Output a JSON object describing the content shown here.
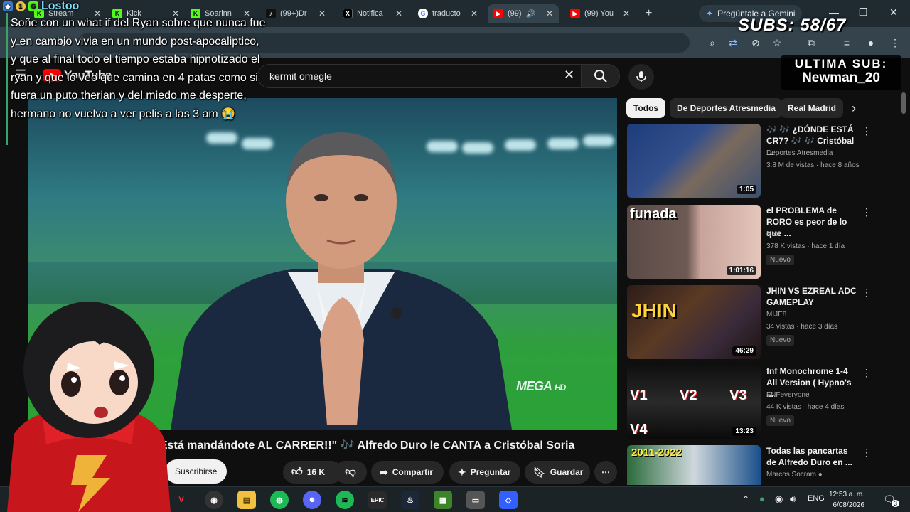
{
  "browser": {
    "tabs": [
      {
        "label": "Stream",
        "icon": "kick-icon"
      },
      {
        "label": "Kick",
        "icon": "kick-icon"
      },
      {
        "label": "Soarinn",
        "icon": "kick-icon"
      },
      {
        "label": "(99+)Dr",
        "icon": "tiktok-icon"
      },
      {
        "label": "Notifica",
        "icon": "x-icon"
      },
      {
        "label": "traducto",
        "icon": "google-icon"
      },
      {
        "label": "(99)",
        "icon": "youtube-icon"
      },
      {
        "label": "(99) You",
        "icon": "youtube-icon"
      }
    ],
    "gemini_label": "Pregúntale a Gemini"
  },
  "youtube": {
    "logo_text": "YouTube",
    "search_value": "kermit omegle",
    "video_title": "? ¡¡Está mandándote AL CARRER!!\" 🎶 Alfredo Duro le CANTA a Cristóbal Soria",
    "watermark": "MEGA",
    "watermark_hd": "HD",
    "actions": {
      "subscribe": "Suscribirse",
      "likes": "16 K",
      "share": "Compartir",
      "ask": "Preguntar",
      "save": "Guardar"
    },
    "chips": [
      "Todos",
      "De Deportes Atresmedia",
      "Real Madrid"
    ],
    "recommendations": [
      {
        "title": "🎶 🎶 ¿DÓNDE ESTÁ CR7? 🎶 🎶 Cristóbal ...",
        "channel": "Deportes Atresmedia",
        "meta": "3.8 M de vistas · hace 8 años",
        "duration": "1:05",
        "badge": "",
        "thumb_text": ""
      },
      {
        "title": "el PROBLEMA de RORO es peor de lo que ...",
        "channel": "Natx",
        "meta": "378 K vistas · hace 1 día",
        "duration": "1:01:16",
        "badge": "Nuevo",
        "thumb_text": "funada"
      },
      {
        "title": "JHIN VS EZREAL ADC GAMEPLAY",
        "channel": "MIJE8",
        "meta": "34 vistas · hace 3 días",
        "duration": "46:29",
        "badge": "Nuevo",
        "thumb_text": "JHIN"
      },
      {
        "title": "fnf Monochrome 1-4 All Version ( Hypno's ...",
        "channel": "FNFeveryone",
        "meta": "44 K vistas · hace 4 días",
        "duration": "13:23",
        "badge": "Nuevo",
        "thumb_text": "V1 V2 V3 V4"
      },
      {
        "title": "Todas las pancartas de Alfredo Duro en ...",
        "channel": "Marcos Socram ●",
        "meta": "",
        "duration": "",
        "badge": "",
        "thumb_text": "2011-2022"
      }
    ]
  },
  "overlay": {
    "chat_user": "Lostoo",
    "chat_message": "Soñe con un what if del Ryan sobre que nunca fue y en cambio vivia en un mundo post-apocaliptico, y que al final todo el tiempo estaba hipnotizado el ryan y que lo veo que camina en 4 patas como si fuera un puto therian y del miedo me desperte, hermano no vuelvo a ver pelis a las 3 am",
    "chat_badge": "1",
    "subs_label": "SUBS:",
    "subs_value": "58/67",
    "last_sub_label": "ULTIMA SUB:",
    "last_sub_name": "Newman_20"
  },
  "taskbar": {
    "language": "ENG",
    "time": "12:53 a. m.",
    "date": "6/08/2026",
    "notifications": "3"
  },
  "colors": {
    "youtube_red": "#ff0000",
    "kick_green": "#53fc18",
    "background": "#0f0f0f"
  }
}
